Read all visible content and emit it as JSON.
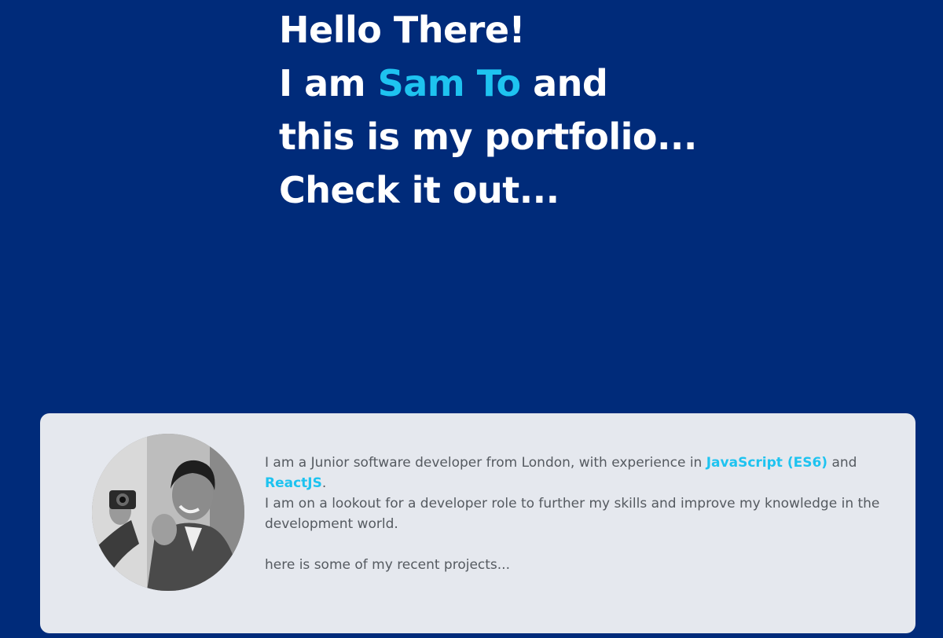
{
  "hero": {
    "line1": "Hello There!",
    "line2_prefix": "I am ",
    "line2_name": "Sam To",
    "line2_suffix": " and",
    "line3": "this is my portfolio...",
    "line4": "Check it out..."
  },
  "about": {
    "p1_a": "I am a Junior software developer from London, with experience in ",
    "p1_skill1": "JavaScript (ES6)",
    "p1_b": " and",
    "p1_skill2": "ReactJS",
    "p1_c": ".",
    "p2": "I am on a lookout for a developer role to further my skills and improve my knowledge in the development world.",
    "p3": "here is some of my recent projects..."
  },
  "colors": {
    "background": "#002b7a",
    "accent": "#1ec3f0",
    "card": "#e5e8ee",
    "body_text": "#555a60"
  },
  "icons": {
    "avatar": "profile-photo"
  }
}
